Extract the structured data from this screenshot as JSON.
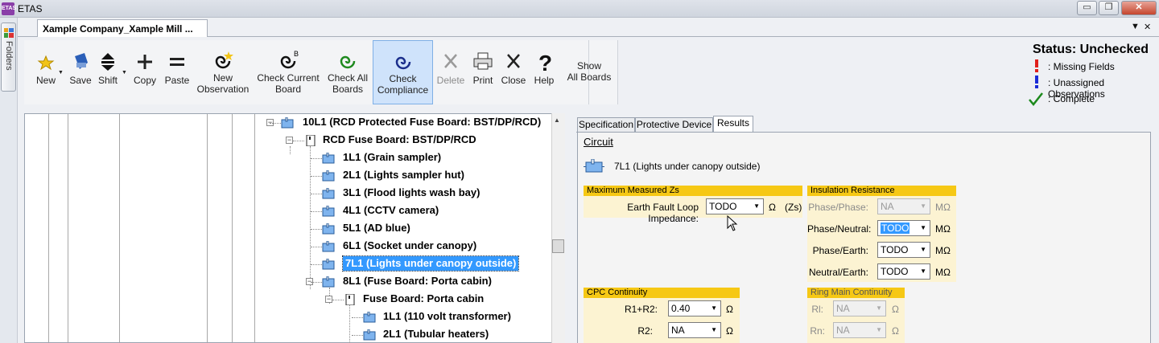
{
  "window": {
    "app_logo": "ETAS",
    "title": "ETAS",
    "min_glyph": "▭",
    "max_glyph": "❐",
    "close_glyph": "✕"
  },
  "folders": {
    "label": "Folders"
  },
  "doc_tab": {
    "title": "Xample Company_Xample Mill ...",
    "menu_glyph": "▼",
    "close_glyph": "✕"
  },
  "ribbon": {
    "new": "New",
    "save": "Save",
    "shift": "Shift",
    "copy": "Copy",
    "paste": "Paste",
    "new_observation": "New\nObservation",
    "check_current_board": "Check Current\nBoard",
    "check_all_boards": "Check All\nBoards",
    "check_compliance": "Check\nCompliance",
    "delete": "Delete",
    "print": "Print",
    "close": "Close",
    "help": "Help",
    "show_all_boards": "Show\nAll Boards"
  },
  "status": {
    "title": "Status: Unchecked",
    "legend": {
      "missing": ": Missing Fields",
      "unassigned": ": Unassigned Observations",
      "complete": ": Complete"
    },
    "colors": {
      "missing": "#e0201c",
      "unassigned": "#1a2bd6",
      "complete": "#1c8a1c"
    }
  },
  "tree": {
    "nodes": [
      "10L1 (RCD Protected Fuse Board: BST/DP/RCD)",
      "RCD Fuse Board: BST/DP/RCD",
      "1L1 (Grain sampler)",
      "2L1 (Lights sampler hut)",
      "3L1 (Flood lights wash bay)",
      "4L1 (CCTV camera)",
      "5L1 (AD blue)",
      "6L1 (Socket under canopy)",
      "7L1 (Lights under canopy outside)",
      "8L1 (Fuse Board: Porta cabin)",
      "Fuse Board: Porta cabin",
      "1L1 (110 volt transformer)",
      "2L1 (Tubular heaters)"
    ],
    "selected_index": 8
  },
  "panel": {
    "tabs": [
      "Specification",
      "Protective Device",
      "Results"
    ],
    "active_tab": "Results",
    "circuit_heading": "Circuit",
    "circuit_name": "7L1 (Lights under canopy outside)",
    "max_zs": {
      "header": "Maximum Measured Zs",
      "label": "Earth Fault Loop Impedance:",
      "value": "TODO",
      "unit": "Ω",
      "suffix": "(Zs)"
    },
    "insulation": {
      "header": "Insulation Resistance",
      "phase_phase_label": "Phase/Phase:",
      "phase_phase_value": "NA",
      "phase_neutral_label": "Phase/Neutral:",
      "phase_neutral_value": "TODO",
      "phase_earth_label": "Phase/Earth:",
      "phase_earth_value": "TODO",
      "neutral_earth_label": "Neutral/Earth:",
      "neutral_earth_value": "TODO",
      "unit": "MΩ"
    },
    "cpc": {
      "header": "CPC Continuity",
      "r1r2_label": "R1+R2:",
      "r1r2_value": "0.40",
      "r2_label": "R2:",
      "r2_value": "NA",
      "unit": "Ω"
    },
    "ring": {
      "header": "Ring Main Continuity",
      "rl_label": "Rl:",
      "rl_value": "NA",
      "rn_label": "Rn:",
      "rn_value": "NA",
      "unit": "Ω"
    }
  }
}
